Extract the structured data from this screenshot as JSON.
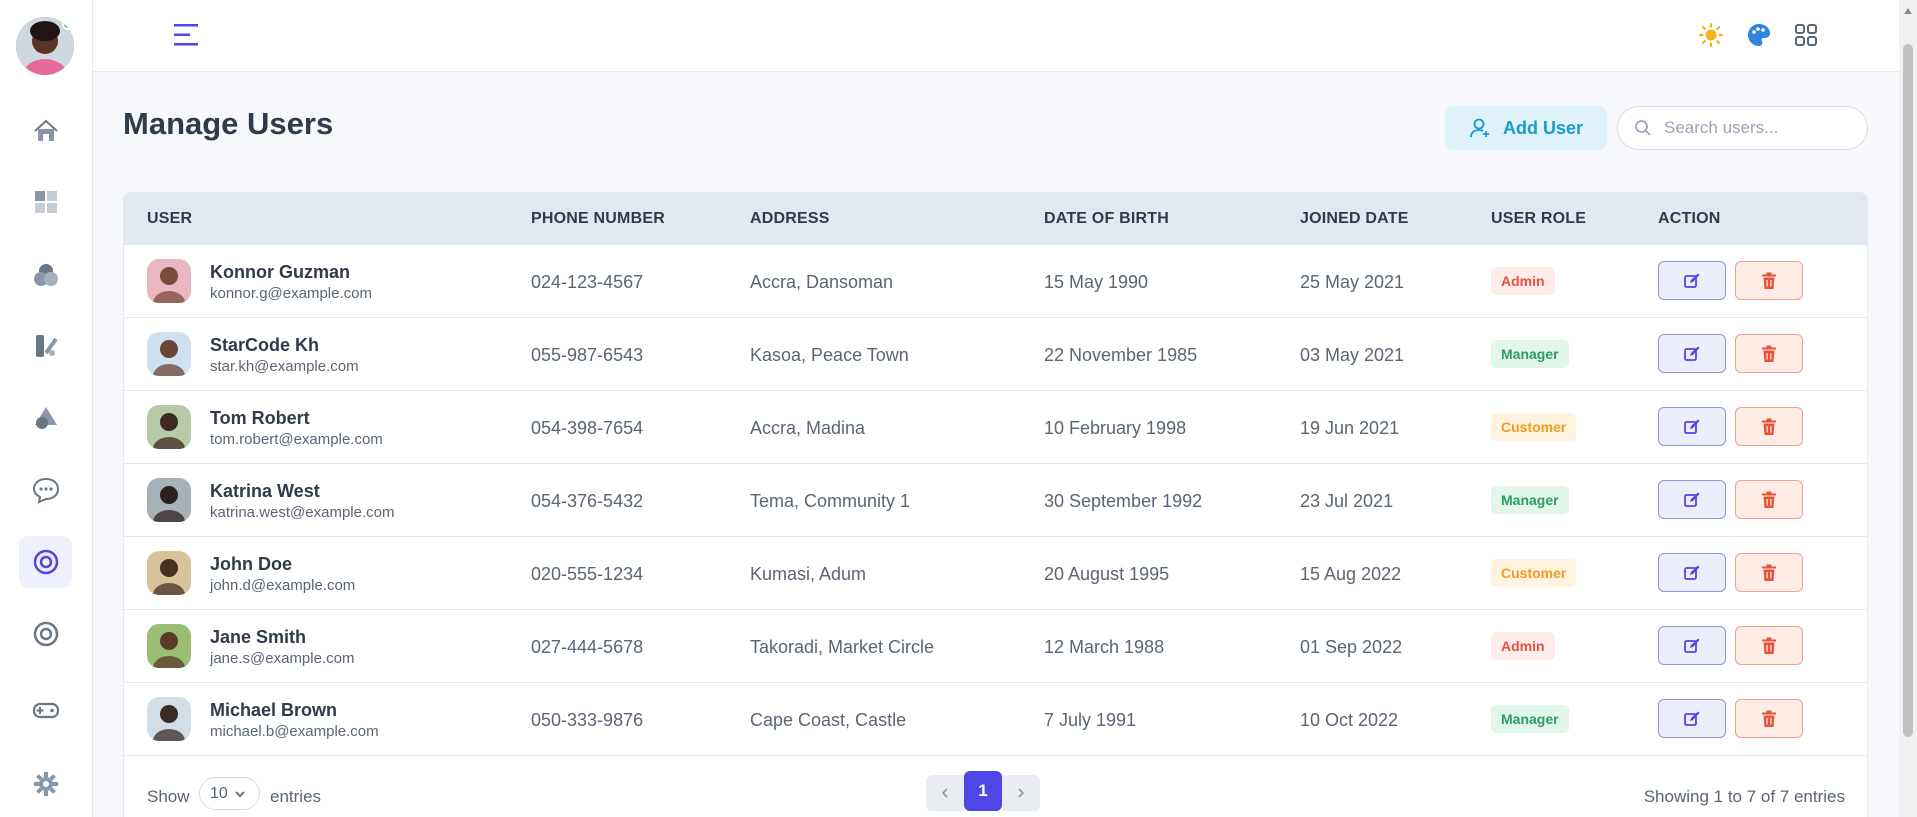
{
  "sidebar": {
    "items": [
      {
        "icon": "home-icon",
        "active": false
      },
      {
        "icon": "dashboard-icon",
        "active": false
      },
      {
        "icon": "shapes-icon",
        "active": false
      },
      {
        "icon": "widgets-icon",
        "active": false
      },
      {
        "icon": "layers-icon",
        "active": false
      },
      {
        "icon": "chat-icon",
        "active": false
      },
      {
        "icon": "target-icon",
        "active": true
      },
      {
        "icon": "circle-icon",
        "active": false
      },
      {
        "icon": "gamepad-icon",
        "active": false
      },
      {
        "icon": "settings-icon",
        "active": false
      }
    ]
  },
  "topbar": {
    "icons": [
      "menu-icon",
      "sun-icon",
      "palette-icon",
      "apps-grid-icon"
    ],
    "colors": {
      "menu": "#4f46e5",
      "sun": "#f5b21a",
      "palette": "#2f86e0",
      "grid": "#5a6575"
    }
  },
  "header": {
    "title": "Manage Users",
    "add_user_label": "Add User",
    "search_placeholder": "Search users..."
  },
  "table": {
    "columns": [
      "USER",
      "PHONE NUMBER",
      "ADDRESS",
      "DATE OF BIRTH",
      "JOINED DATE",
      "USER ROLE",
      "ACTION"
    ],
    "rows": [
      {
        "name": "Konnor Guzman",
        "email": "konnor.g@example.com",
        "phone": "024-123-4567",
        "address": "Accra, Dansoman",
        "dob": "15 May 1990",
        "joined": "25 May 2021",
        "role": "Admin"
      },
      {
        "name": "StarCode Kh",
        "email": "star.kh@example.com",
        "phone": "055-987-6543",
        "address": "Kasoa, Peace Town",
        "dob": "22 November 1985",
        "joined": "03 May 2021",
        "role": "Manager"
      },
      {
        "name": "Tom Robert",
        "email": "tom.robert@example.com",
        "phone": "054-398-7654",
        "address": "Accra, Madina",
        "dob": "10 February 1998",
        "joined": "19 Jun 2021",
        "role": "Customer"
      },
      {
        "name": "Katrina West",
        "email": "katrina.west@example.com",
        "phone": "054-376-5432",
        "address": "Tema, Community 1",
        "dob": "30 September 1992",
        "joined": "23 Jul 2021",
        "role": "Manager"
      },
      {
        "name": "John Doe",
        "email": "john.d@example.com",
        "phone": "020-555-1234",
        "address": "Kumasi, Adum",
        "dob": "20 August 1995",
        "joined": "15 Aug 2022",
        "role": "Customer"
      },
      {
        "name": "Jane Smith",
        "email": "jane.s@example.com",
        "phone": "027-444-5678",
        "address": "Takoradi, Market Circle",
        "dob": "12 March 1988",
        "joined": "01 Sep 2022",
        "role": "Admin"
      },
      {
        "name": "Michael Brown",
        "email": "michael.b@example.com",
        "phone": "050-333-9876",
        "address": "Cape Coast, Castle",
        "dob": "7 July 1991",
        "joined": "10 Oct 2022",
        "role": "Manager"
      }
    ]
  },
  "footer": {
    "show_label": "Show",
    "entries_value": "10",
    "entries_label": "entries",
    "current_page": "1",
    "showing_text": "Showing 1 to 7 of 7 entries"
  },
  "colors": {
    "accent": "#4f46e5",
    "admin": "#e2553b",
    "manager": "#2a9d62",
    "customer": "#f39a23",
    "add_user": "#1a9cc9"
  }
}
